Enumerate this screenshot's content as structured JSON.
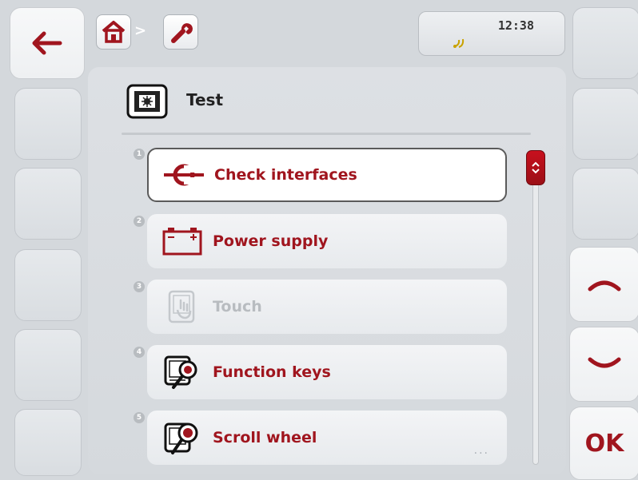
{
  "status": {
    "time": "12:38",
    "connection_icon": "connection-indicator-icon"
  },
  "breadcrumb": {
    "items": [
      "home-icon",
      "wrench-icon"
    ],
    "separator": ">"
  },
  "page": {
    "title": "Test",
    "title_icon": "terminal-test-icon"
  },
  "menu": {
    "items": [
      {
        "number": "1",
        "label": "Check interfaces",
        "icon": "interface-check-icon",
        "state": "selected"
      },
      {
        "number": "2",
        "label": "Power supply",
        "icon": "battery-icon",
        "state": "enabled"
      },
      {
        "number": "3",
        "label": "Touch",
        "icon": "touch-screen-icon",
        "state": "disabled"
      },
      {
        "number": "4",
        "label": "Function keys",
        "icon": "function-keys-icon",
        "state": "enabled"
      },
      {
        "number": "5",
        "label": "Scroll wheel",
        "icon": "scroll-wheel-icon",
        "state": "enabled"
      }
    ],
    "more_indicator": "..."
  },
  "softkeys": {
    "ok_label": "OK"
  },
  "colors": {
    "accent": "#a0151e",
    "background": "#d4d8dc"
  }
}
